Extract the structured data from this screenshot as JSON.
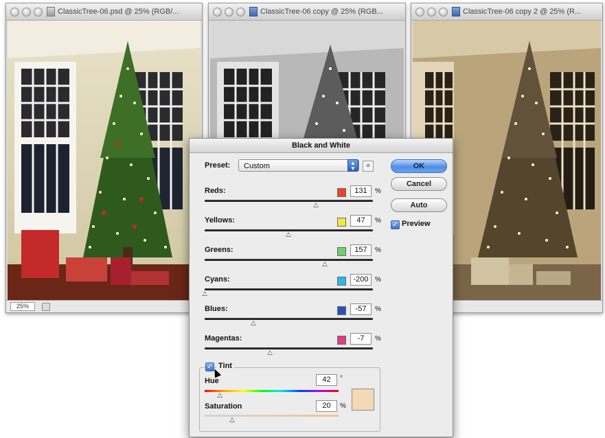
{
  "windows": [
    {
      "title": "ClassicTree-06.psd @ 25% (RGB/...",
      "zoom": "25%",
      "mode": "color"
    },
    {
      "title": "ClassicTree-06 copy @ 25% (RGB...",
      "mode": "bw"
    },
    {
      "title": "ClassicTree-06 copy 2 @ 25% (R...",
      "mode": "sepia"
    }
  ],
  "dialog": {
    "title": "Black and White",
    "preset_label": "Preset:",
    "preset_value": "Custom",
    "ok_label": "OK",
    "cancel_label": "Cancel",
    "auto_label": "Auto",
    "preview_label": "Preview",
    "preview_checked": true,
    "percent": "%",
    "degree": "°",
    "sliders": [
      {
        "label": "Reds:",
        "value": "131",
        "color": "#e8452a"
      },
      {
        "label": "Yellows:",
        "value": "47",
        "color": "#efe83e"
      },
      {
        "label": "Greens:",
        "value": "157",
        "color": "#6fcf6b"
      },
      {
        "label": "Cyans:",
        "value": "-200",
        "color": "#2fb8e6"
      },
      {
        "label": "Blues:",
        "value": "-57",
        "color": "#2d4fbf"
      },
      {
        "label": "Magentas:",
        "value": "-7",
        "color": "#e33a8a"
      }
    ],
    "tint": {
      "label": "Tint",
      "checked": true,
      "hue_label": "Hue",
      "hue_value": "42",
      "saturation_label": "Saturation",
      "saturation_value": "20",
      "swatch_color": "#f4d9b6"
    }
  }
}
